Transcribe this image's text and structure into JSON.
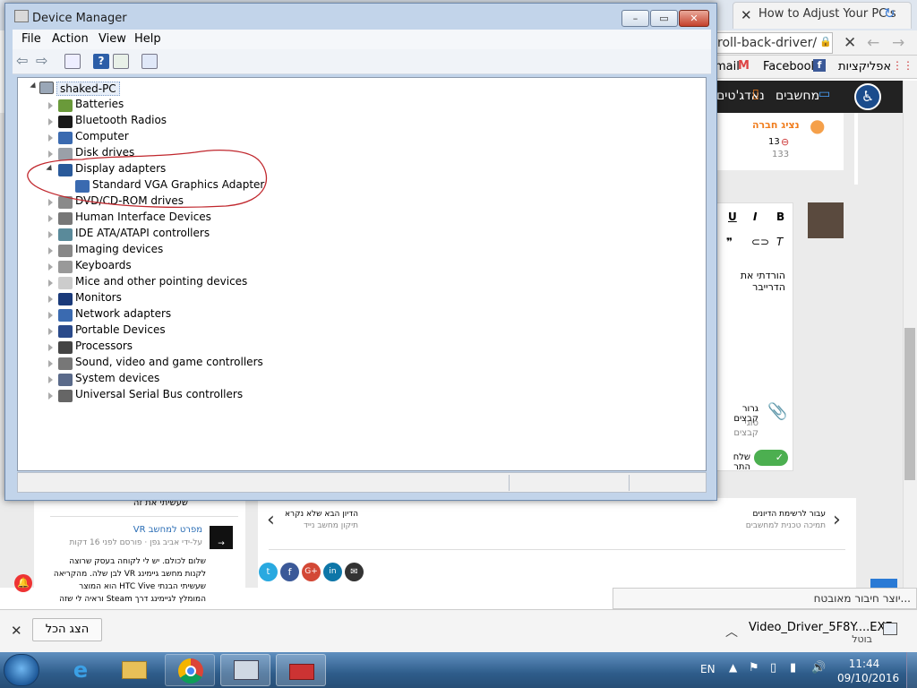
{
  "browser": {
    "tab_title": "How to Adjust Your PC's",
    "address": "roll-back-driver/",
    "bookmarks": [
      "mail",
      "Facebook",
      "אפליקציות"
    ],
    "site_nav": [
      "נאדג'טים",
      "מחשבים"
    ],
    "profile_link": "נציג חברה",
    "profile_count": "13",
    "profile_views": "133",
    "editor_buttons": [
      "U",
      "I",
      "B"
    ],
    "editor_text": "הורדתי את הדרייבר",
    "attach_label": "גרור קבצים",
    "attach_sub": "סוגי קבצים",
    "send_label": "שלח התר",
    "side_link_1": "שעשיתי את זה",
    "article_title": "מפרט למחשב VR",
    "article_meta": "על-ידי אביב גפן · פורסם לפני 16 דקות",
    "article_body": "שלום לכולם. יש לי לקוחה בעסק שרוצה לקנות מחשב גיימינג VR לבן שלה. מהקריאה שעשיתי הבנתי HTC Vive הוא המוצר המומלץ לגיימינג דרך Steam וראיה לי שזה",
    "next_label": "הדיון הבא שלא נקרא",
    "next_sub": "תיקון מחשב נייד",
    "back_label": "עבור לרשימת הדיונים",
    "back_sub": "תמיכה טכנית למחשבים",
    "typing_notice": "...יוצר חיבור מאובטח"
  },
  "device_manager": {
    "title": "Device Manager",
    "menu": [
      "File",
      "Action",
      "View",
      "Help"
    ],
    "root": "shaked-PC",
    "items": [
      "Batteries",
      "Bluetooth Radios",
      "Computer",
      "Disk drives",
      "Display adapters",
      "Standard VGA Graphics Adapter",
      "DVD/CD-ROM drives",
      "Human Interface Devices",
      "IDE ATA/ATAPI controllers",
      "Imaging devices",
      "Keyboards",
      "Mice and other pointing devices",
      "Monitors",
      "Network adapters",
      "Portable Devices",
      "Processors",
      "Sound, video and game controllers",
      "System devices",
      "Universal Serial Bus controllers"
    ]
  },
  "downloads": {
    "show_all": "הצג הכל",
    "file_name": "Video_Driver_5F8Y....EXE",
    "file_status": "בוטל"
  },
  "taskbar": {
    "lang": "EN",
    "time": "11:44",
    "date": "09/10/2016"
  },
  "colors": {
    "accent_orange": "#f07c1c",
    "annotation_red": "#c0272d",
    "window_frame": "#c2d4ea"
  }
}
